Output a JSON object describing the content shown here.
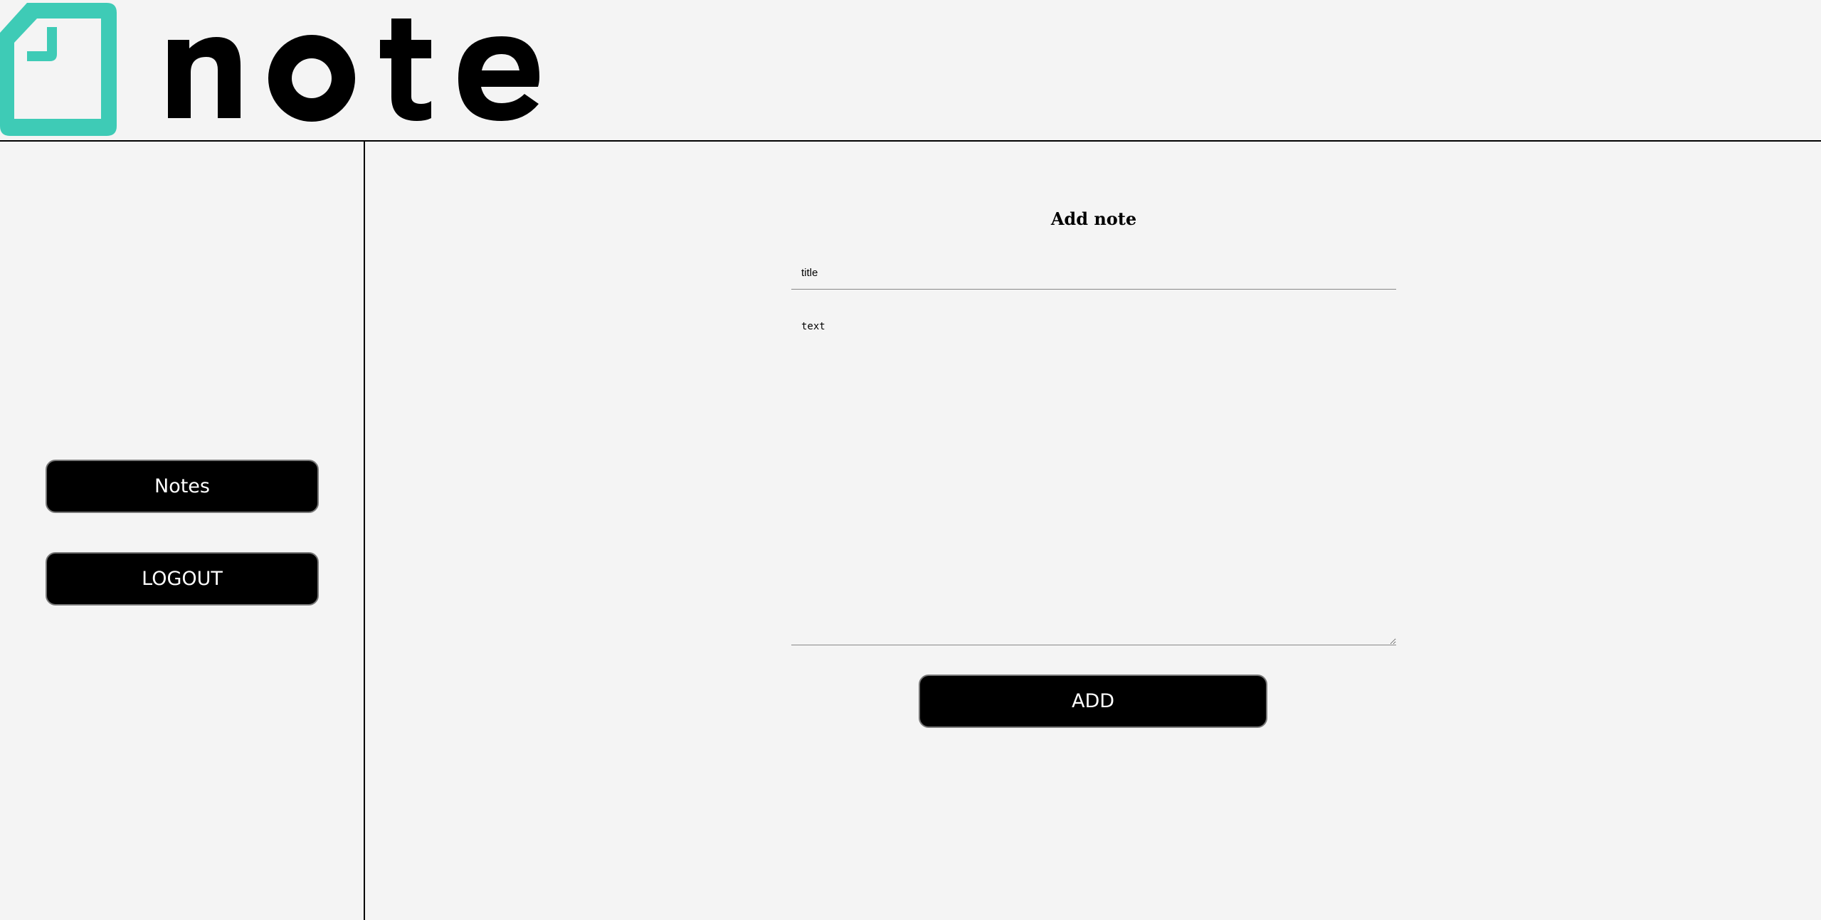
{
  "header": {
    "logo_text": "note",
    "brand_color": "#3ecbb6"
  },
  "sidebar": {
    "items": [
      {
        "label": "Notes"
      },
      {
        "label": "LOGOUT"
      }
    ]
  },
  "main": {
    "form_title": "Add note",
    "title_placeholder": "title",
    "text_placeholder": "text",
    "add_label": "ADD"
  }
}
